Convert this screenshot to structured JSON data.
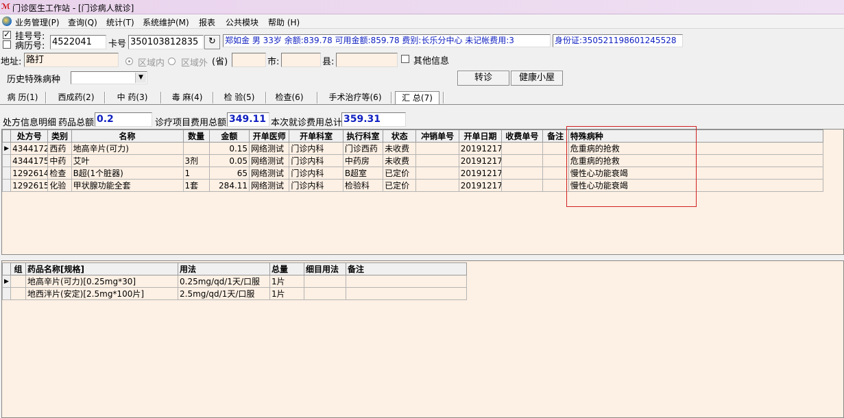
{
  "window": {
    "title": "门诊医生工作站 - [门诊病人就诊]"
  },
  "menu": [
    "业务管理(P)",
    "查询(Q)",
    "统计(T)",
    "系统维护(M)",
    "报表",
    "公共模块",
    "帮助 (H)"
  ],
  "header": {
    "reg_label": "挂号号:",
    "record_label": "病历号:",
    "reg_value": "4522041",
    "card_label": "卡号",
    "card_value": "350103812835",
    "patient_info": "郑如金 男 33岁 余额:839.78 可用金额:859.78 费别:长乐分中心 未记帐费用:3",
    "id_info": "身份证:350521198601245528"
  },
  "address": {
    "label": "地址:",
    "value": "路打",
    "inside": "区域内",
    "outside": "区域外",
    "province": "(省)",
    "city": "市:",
    "county": "县:",
    "other": "其他信息"
  },
  "history": {
    "label": "历史特殊病种",
    "value": ""
  },
  "buttons": {
    "transfer": "转诊",
    "health": "健康小屋"
  },
  "tabs": [
    "病 历(1)",
    "西成药(2)",
    "中 药(3)",
    "毒 麻(4)",
    "检 验(5)",
    "检查(6)",
    "手术治疗等(6)",
    "汇 总(7)"
  ],
  "summary": {
    "detail_label": "处方信息明细",
    "drug_total_label": "药品总额",
    "drug_total": "0.2",
    "item_total_label": "诊疗项目费用总额",
    "item_total": "349.11",
    "visit_total_label": "本次就诊费用总计",
    "visit_total": "359.31"
  },
  "main_table": {
    "headers": [
      "处方号",
      "类别",
      "名称",
      "数量",
      "金额",
      "开单医师",
      "开单科室",
      "执行科室",
      "状态",
      "冲销单号",
      "开单日期",
      "收费单号",
      "备注",
      "特殊病种"
    ],
    "rows": [
      [
        "4344172",
        "西药",
        "地高辛片(可力)",
        "",
        "0.15",
        "网络测试",
        "门诊内科",
        "门诊西药",
        "未收费",
        "",
        "20191217",
        "",
        "",
        "危重病的抢救"
      ],
      [
        "4344175",
        "中药",
        "艾叶",
        "3剂",
        "0.05",
        "网络测试",
        "门诊内科",
        "中药房",
        "未收费",
        "",
        "20191217",
        "",
        "",
        "危重病的抢救"
      ],
      [
        "1292614",
        "检查",
        "B超(1个脏器)",
        "1",
        "65",
        "网络测试",
        "门诊内科",
        "B超室",
        "已定价",
        "",
        "20191217",
        "",
        "",
        "慢性心功能衰竭"
      ],
      [
        "1292615",
        "化验",
        "甲状腺功能全套",
        "1套",
        "284.11",
        "网络测试",
        "门诊内科",
        "检验科",
        "已定价",
        "",
        "20191217",
        "",
        "",
        "慢性心功能衰竭"
      ]
    ]
  },
  "drug_table": {
    "headers": [
      "组",
      "药品名称[规格]",
      "用法",
      "总量",
      "细目用法",
      "备注"
    ],
    "rows": [
      [
        "",
        "地高辛片(可力)[0.25mg*30]",
        "0.25mg/qd/1天/口服",
        "1片",
        "",
        ""
      ],
      [
        "",
        "地西泮片(安定)[2.5mg*100片]",
        "2.5mg/qd/1天/口服",
        "1片",
        "",
        ""
      ]
    ]
  },
  "colors": {
    "panel": "#fdf0e4",
    "highlight": "#d02020",
    "info_text": "#1020c0",
    "title_bar": "#e9d3ec"
  }
}
